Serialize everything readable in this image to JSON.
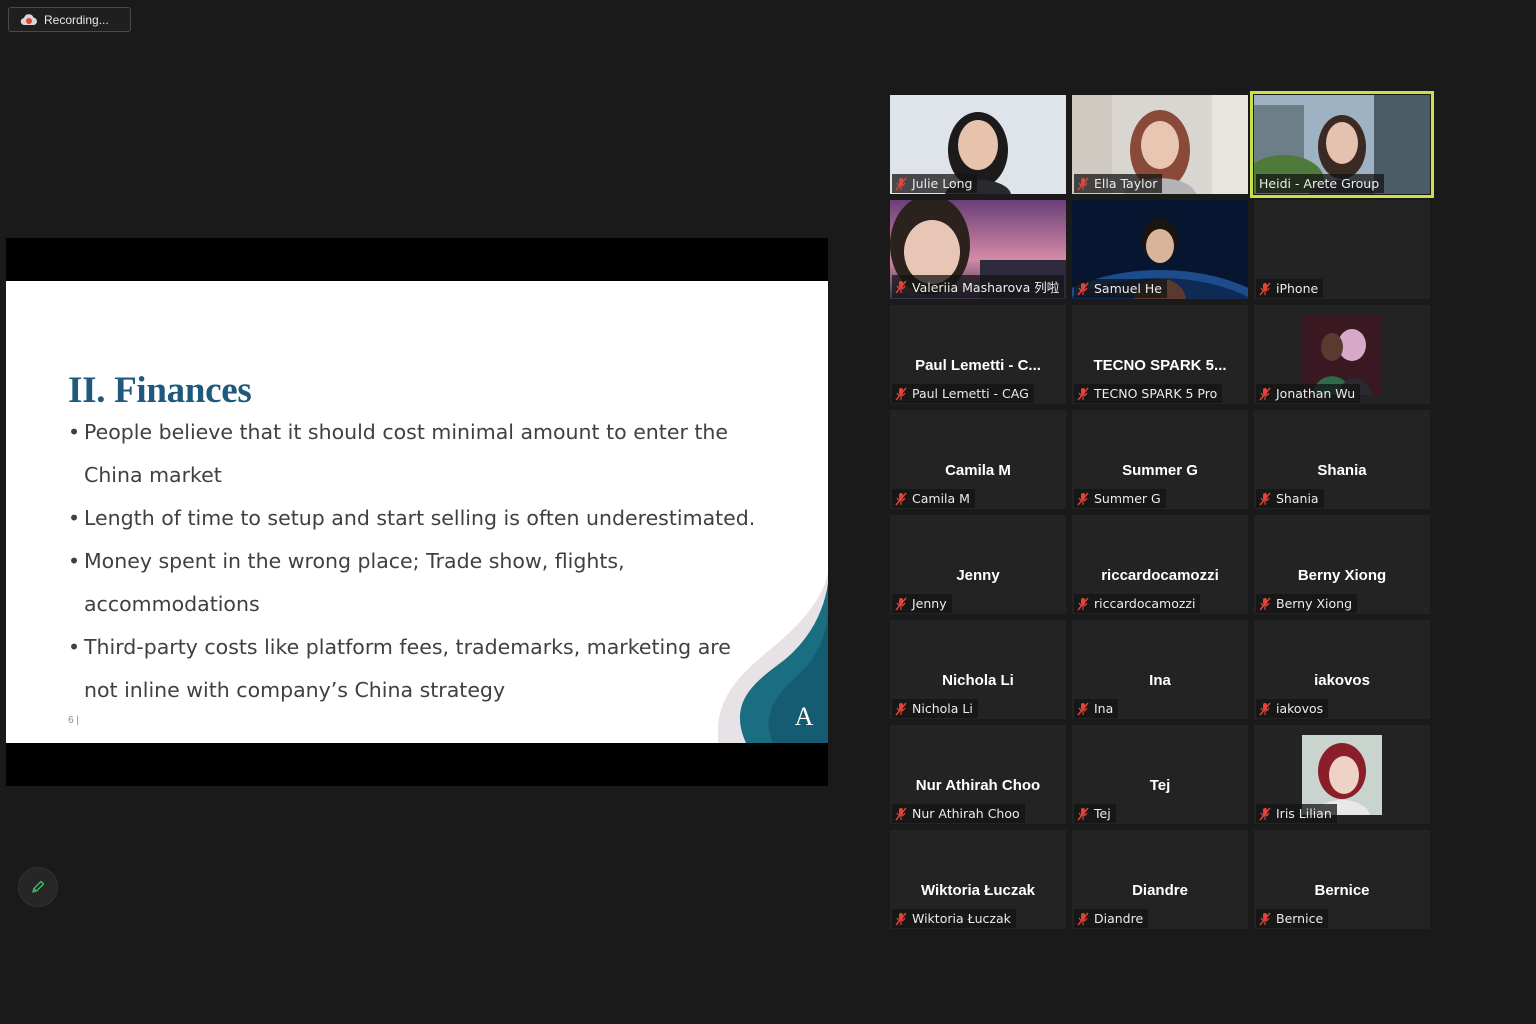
{
  "recording": {
    "label": "Recording..."
  },
  "slide": {
    "title": "II. Finances",
    "bullets": [
      "People believe that it should cost minimal amount to enter the China market",
      "Length of time to setup and start selling is often underestimated.",
      "Money spent in the wrong place; Trade show, flights, accommodations",
      "Third-party costs like platform fees, trademarks, marketing are not inline with company’s China strategy"
    ],
    "page_number": "6 |",
    "logo_letter": "A"
  },
  "participants": [
    {
      "name": "Julie Long"
    },
    {
      "name": "Ella Taylor"
    },
    {
      "name": "Heidi - Arete Group"
    },
    {
      "name": "Valeriia Masharova 列啦"
    },
    {
      "name": "Samuel He"
    },
    {
      "name": "iPhone"
    },
    {
      "display": "Paul Lemetti - C...",
      "name": "Paul Lemetti - CAG"
    },
    {
      "display": "TECNO SPARK 5...",
      "name": "TECNO SPARK 5 Pro"
    },
    {
      "name": "Jonathan Wu"
    },
    {
      "display": "Camila M",
      "name": "Camila M"
    },
    {
      "display": "Summer G",
      "name": "Summer G"
    },
    {
      "display": "Shania",
      "name": "Shania"
    },
    {
      "display": "Jenny",
      "name": "Jenny"
    },
    {
      "display": "riccardocamozzi",
      "name": "riccardocamozzi"
    },
    {
      "display": "Berny Xiong",
      "name": "Berny Xiong"
    },
    {
      "display": "Nichola Li",
      "name": "Nichola Li"
    },
    {
      "display": "Ina",
      "name": "Ina"
    },
    {
      "display": "iakovos",
      "name": "iakovos"
    },
    {
      "display": "Nur Athirah Choo",
      "name": "Nur Athirah Choo"
    },
    {
      "display": "Tej",
      "name": "Tej"
    },
    {
      "name": "Iris Lilian"
    },
    {
      "display": "Wiktoria Łuczak",
      "name": "Wiktoria Łuczak"
    },
    {
      "display": "Diandre",
      "name": "Diandre"
    },
    {
      "display": "Bernice",
      "name": "Bernice"
    }
  ],
  "colors": {
    "active_speaker": "#c9e04a",
    "slide_title": "#1f5a7e",
    "mute_icon": "#e0443a"
  }
}
